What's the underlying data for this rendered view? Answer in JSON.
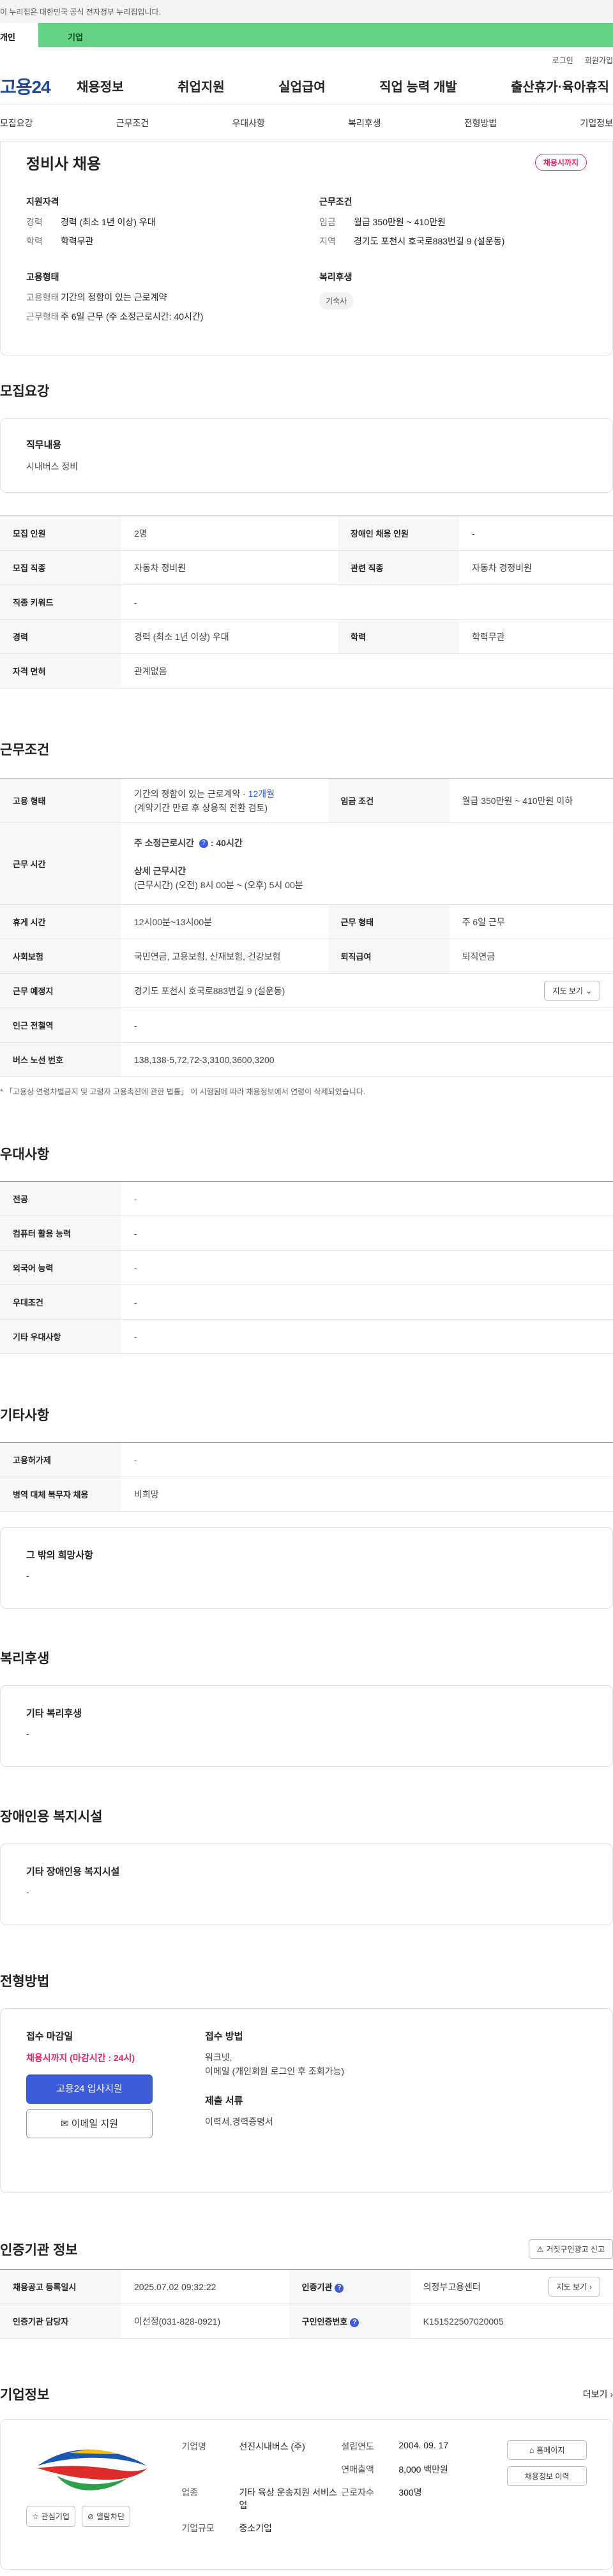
{
  "gov_strip": "이 누리집은 대한민국 공식 전자정부 누리집입니다.",
  "member_tabs": {
    "personal": "개인",
    "company": "기업"
  },
  "top_links": [
    "로그인",
    "회원가입"
  ],
  "logo": "고용24",
  "gnb": [
    "채용정보",
    "취업지원",
    "실업급여",
    "직업 능력 개발",
    "출산휴가·육아휴직"
  ],
  "anchor_nav": [
    "모집요강",
    "근무조건",
    "우대사항",
    "복리후생",
    "전형방법",
    "기업정보"
  ],
  "summary": {
    "title": "정비사 채용",
    "badge": "채용시까지",
    "qual": {
      "heading": "지원자격",
      "career_k": "경력",
      "career_v": "경력 (최소 1년 이상) 우대",
      "edu_k": "학력",
      "edu_v": "학력무관"
    },
    "cond": {
      "heading": "근무조건",
      "wage_k": "임금",
      "wage_v": "월급 350만원 ~ 410만원",
      "area_k": "지역",
      "area_v": "경기도 포천시 호국로883번길 9 (설운동)"
    },
    "emp": {
      "heading": "고용형태",
      "type_k": "고용형태",
      "type_v": "기간의 정함이 있는 근로계약",
      "form_k": "근무형태",
      "form_v": "주 6일 근무 (주 소정근로시간: 40시간)"
    },
    "welfare": {
      "heading": "복리후생",
      "tag": "기숙사"
    }
  },
  "recruit": {
    "section_title": "모집요강",
    "duty_k": "직무내용",
    "duty_v": "시내버스 정비",
    "rows": {
      "count_k": "모집 인원",
      "count_v": "2명",
      "disab_k": "장애인 채용 인원",
      "disab_v": "-",
      "job_k": "모집 직종",
      "job_v": "자동차 정비원",
      "rel_k": "관련 직종",
      "rel_v": "자동차 경정비원",
      "kw_k": "직종 키워드",
      "kw_v": "-",
      "career_k": "경력",
      "career_v": "경력 (최소 1년 이상) 우대",
      "edu_k": "학력",
      "edu_v": "학력무관",
      "lic_k": "자격 면허",
      "lic_v": "관계없음"
    }
  },
  "work": {
    "section_title": "근무조건",
    "emp_k": "고용 형태",
    "emp_v1": "기간의 정함이 있는 근로계약 · ",
    "emp_v1_blue": "12개월",
    "emp_v2": "(계약기간 만료 후 상용직 전환 검토)",
    "wage_k": "임금 조건",
    "wage_v": "월급 350만원 ~ 410만원 이하",
    "time_k": "근무 시간",
    "time_v1": "주 소정근로시간",
    "time_v1b": ": 40시간",
    "time_v2": "상세 근무시간",
    "time_v3": "(근무시간) (오전) 8시 00분 ~ (오후) 5시 00분",
    "rest_k": "휴게 시간",
    "rest_v": "12시00분~13시00분",
    "form_k": "근무 형태",
    "form_v": "주 6일 근무",
    "ins_k": "사회보험",
    "ins_v": "국민연금, 고용보험, 산재보험, 건강보험",
    "ret_k": "퇴직급여",
    "ret_v": "퇴직연금",
    "loc_k": "근무 예정지",
    "loc_v": "경기도 포천시 호국로883번길 9 (설운동)",
    "map_btn": "지도 보기",
    "sub_k": "인근 전철역",
    "sub_v": "-",
    "bus_k": "버스 노선 번호",
    "bus_v": "138,138-5,72,72-3,3100,3600,3200",
    "note": "* 「고용상 연령차별금지 및 고령자 고용촉진에 관한 법률」 이 시행됨에 따라 채용정보에서 연령이 삭제되었습니다."
  },
  "pref": {
    "section_title": "우대사항",
    "rows": [
      {
        "k": "전공",
        "v": "-"
      },
      {
        "k": "컴퓨터 활용 능력",
        "v": "-"
      },
      {
        "k": "외국어 능력",
        "v": "-"
      },
      {
        "k": "우대조건",
        "v": "-"
      },
      {
        "k": "기타 우대사항",
        "v": "-"
      }
    ]
  },
  "etc": {
    "section_title": "기타사항",
    "rows": [
      {
        "k": "고용허가제",
        "v": "-"
      },
      {
        "k": "병역 대체 복무자 채용",
        "v": "비희망"
      }
    ],
    "other_k": "그 밖의 희망사항",
    "other_v": "-"
  },
  "welfare": {
    "section_title": "복리후생",
    "k": "기타 복리후생",
    "v": "-"
  },
  "disab": {
    "section_title": "장애인용 복지시설",
    "k": "기타 장애인용 복지시설",
    "v": "-"
  },
  "apply": {
    "section_title": "전형방법",
    "deadline_k": "접수 마감일",
    "deadline_v": "채용시까지 (마감시간 : 24시)",
    "btn_apply": "고용24 입사지원",
    "btn_email": "이메일 지원",
    "method_k": "접수 방법",
    "method_v1": "워크넷,",
    "method_v2": "이메일 (개인회원 로그인 후 조회가능)",
    "docs_k": "제출 서류",
    "docs_v": "이력서,경력증명서"
  },
  "cert": {
    "section_title": "인증기관 정보",
    "report_btn": "거짓구인광고 신고",
    "reg_k": "채용공고 등록일시",
    "reg_v": "2025.07.02 09:32:22",
    "org_k": "인증기관",
    "org_v": "의정부고용센터",
    "map_btn": "지도 보기",
    "mgr_k": "인증기관 담당자",
    "mgr_v": "이선정(031-828-0921)",
    "no_k": "구인인증번호",
    "no_v": "K151522507020005"
  },
  "company": {
    "section_title": "기업정보",
    "more": "더보기",
    "btn_fav": "관심기업",
    "btn_block": "열람차단",
    "name_k": "기업명",
    "name_v": "선진시내버스 (주)",
    "year_k": "설립연도",
    "year_v": "2004. 09. 17",
    "sales_k": "연매출액",
    "sales_v": "8,000 백만원",
    "ind_k": "업종",
    "ind_v": "기타 육상 운송지원 서비스업",
    "emp_k": "근로자수",
    "emp_v": "300명",
    "size_k": "기업규모",
    "size_v": "중소기업",
    "btn_home": "홈페이지",
    "btn_history": "채용정보 이력"
  },
  "colors": {
    "accent": "#3b5bdb",
    "danger": "#e8236a",
    "company_tab": "#65d285"
  }
}
